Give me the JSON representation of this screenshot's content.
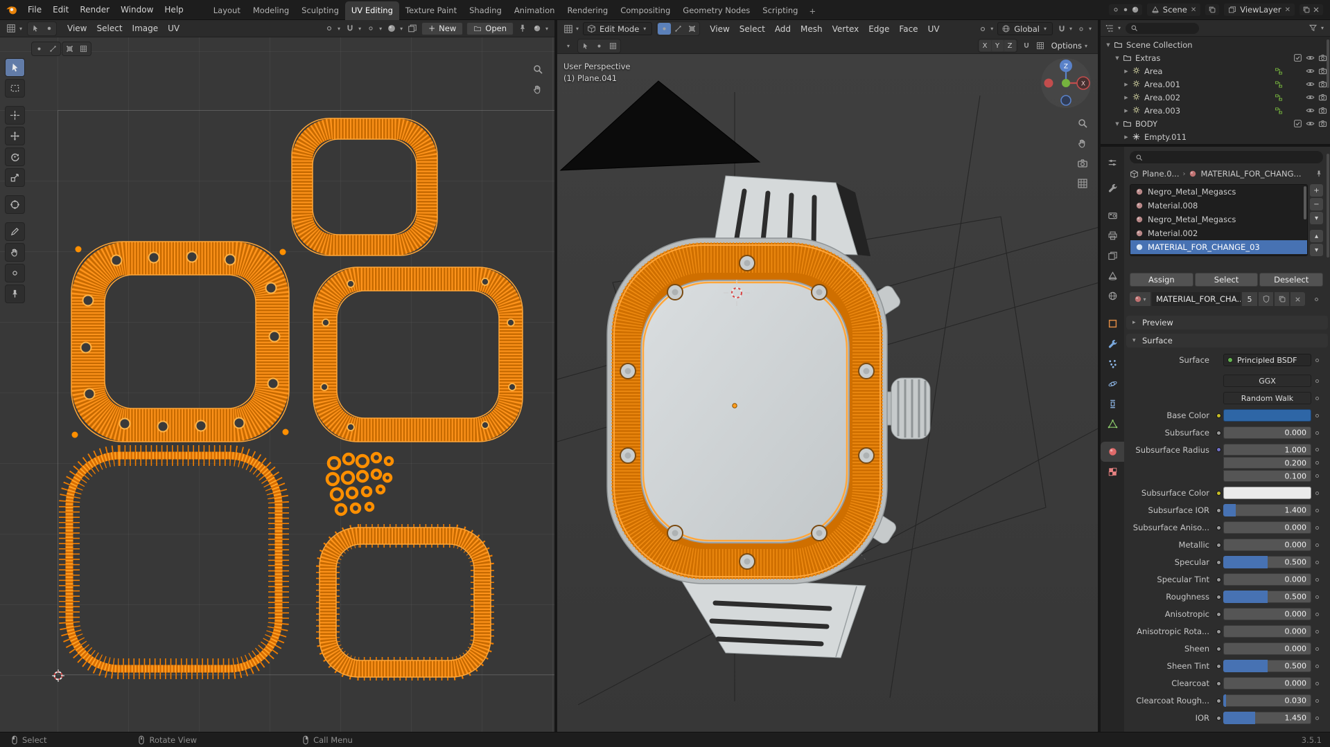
{
  "colors": {
    "accent": "#4772b3",
    "orange": "#e8830a",
    "base_color_swatch": "#2e66a6",
    "subsurface_color_swatch": "#eaeaea"
  },
  "topbar": {
    "app_menus": [
      "File",
      "Edit",
      "Render",
      "Window",
      "Help"
    ],
    "workspaces": [
      "Layout",
      "Modeling",
      "Sculpting",
      "UV Editing",
      "Texture Paint",
      "Shading",
      "Animation",
      "Rendering",
      "Compositing",
      "Geometry Nodes",
      "Scripting"
    ],
    "active_workspace": "UV Editing",
    "add_tab": "+",
    "scene_label": "Scene",
    "viewlayer_label": "ViewLayer"
  },
  "uv_editor": {
    "menus": [
      "View",
      "Select",
      "Image",
      "UV"
    ],
    "new_button": "New",
    "open_button": "Open",
    "tools": [
      "tweak",
      "select-box",
      "cursor",
      "move",
      "rotate",
      "scale",
      "transform",
      "annotate",
      "grab",
      "relax",
      "pin"
    ],
    "nav_icons": [
      "magnifier",
      "hand"
    ]
  },
  "viewport": {
    "mode": "Edit Mode",
    "menus": [
      "View",
      "Select",
      "Add",
      "Mesh",
      "Vertex",
      "Edge",
      "Face",
      "UV"
    ],
    "orientation": "Global",
    "options_button": "Options",
    "mirror_axes": [
      "X",
      "Y",
      "Z"
    ],
    "overlay_perspective": "User Perspective",
    "overlay_object": "(1) Plane.041",
    "gizmo_z": "Z",
    "gizmo_x": "X",
    "nav_icons": [
      "magnifier",
      "hand",
      "camera",
      "grid"
    ]
  },
  "outliner": {
    "rows": [
      {
        "label": "Scene Collection",
        "depth": 0,
        "icon": "collection",
        "iconcolor": "#d8d8d8",
        "arrow": "down",
        "right": "none"
      },
      {
        "label": "Extras",
        "depth": 1,
        "icon": "collection",
        "iconcolor": "#cfcfcf",
        "arrow": "down",
        "right": "collection"
      },
      {
        "label": "Area",
        "depth": 2,
        "icon": "light",
        "iconcolor": "#d6d6a4",
        "arrow": "right",
        "right": "object"
      },
      {
        "label": "Area.001",
        "depth": 2,
        "icon": "light",
        "iconcolor": "#d6d6a4",
        "arrow": "right",
        "right": "object"
      },
      {
        "label": "Area.002",
        "depth": 2,
        "icon": "light",
        "iconcolor": "#d6d6a4",
        "arrow": "right",
        "right": "object"
      },
      {
        "label": "Area.003",
        "depth": 2,
        "icon": "light",
        "iconcolor": "#d6d6a4",
        "arrow": "right",
        "right": "object"
      },
      {
        "label": "BODY",
        "depth": 1,
        "icon": "collection",
        "iconcolor": "#cfcfcf",
        "arrow": "down",
        "right": "collection"
      },
      {
        "label": "Empty.011",
        "depth": 2,
        "icon": "empty",
        "iconcolor": "#cfcfcf",
        "arrow": "right",
        "right": "none"
      }
    ]
  },
  "properties": {
    "tabs": [
      {
        "id": "tool",
        "icon": "wrench",
        "color": "#9c9c9c",
        "group": 0
      },
      {
        "id": "render",
        "icon": "camera-back",
        "color": "#9c9c9c",
        "group": 1
      },
      {
        "id": "output",
        "icon": "printer",
        "color": "#9c9c9c",
        "group": 1
      },
      {
        "id": "view-layer",
        "icon": "images",
        "color": "#9c9c9c",
        "group": 1
      },
      {
        "id": "scene",
        "icon": "cone",
        "color": "#9c9c9c",
        "group": 1
      },
      {
        "id": "world",
        "icon": "globe",
        "color": "#9c9c9c",
        "group": 1
      },
      {
        "id": "object",
        "icon": "square",
        "color": "#de8a44",
        "group": 2
      },
      {
        "id": "modifiers",
        "icon": "wrench",
        "color": "#7aa8dc",
        "group": 2
      },
      {
        "id": "particles",
        "icon": "particles",
        "color": "#8fb8e8",
        "group": 2
      },
      {
        "id": "physics",
        "icon": "physics",
        "color": "#8fb8e8",
        "group": 2
      },
      {
        "id": "constraints",
        "icon": "constraints",
        "color": "#8fb8e8",
        "group": 2
      },
      {
        "id": "object-data",
        "icon": "mesh",
        "color": "#8ecf6c",
        "group": 2
      },
      {
        "id": "material",
        "icon": "sphere",
        "color": "#e06a6a",
        "group": 3,
        "active": true
      },
      {
        "id": "texture",
        "icon": "checker",
        "color": "#e78181",
        "group": 3
      }
    ],
    "breadcrumb_object": "Plane.0...",
    "breadcrumb_material": "MATERIAL_FOR_CHANG...",
    "slots": [
      {
        "name": "Negro_Metal_Megascs",
        "selected": false
      },
      {
        "name": "Material.008",
        "selected": false
      },
      {
        "name": "Negro_Metal_Megascs",
        "selected": false
      },
      {
        "name": "Material.002",
        "selected": false
      },
      {
        "name": "MATERIAL_FOR_CHANGE_03",
        "selected": true
      }
    ],
    "slot_buttons": [
      "+",
      "−",
      "▾",
      "▴",
      "▾"
    ],
    "actions": [
      "Assign",
      "Select",
      "Deselect"
    ],
    "datablock_name": "MATERIAL_FOR_CHA...",
    "datablock_users": "5",
    "preview_section": "Preview",
    "surface_section": "Surface",
    "surface_label": "Surface",
    "surface_shader": "Principled BSDF",
    "distribution": "GGX",
    "subsurface_method": "Random Walk",
    "params": [
      {
        "label": "Base Color",
        "type": "color",
        "color": "#2e66a6",
        "socket": "#c7bd25"
      },
      {
        "label": "Subsurface",
        "type": "slider",
        "value": "0.000",
        "fill": 0,
        "socket": "#9a9a9a"
      },
      {
        "label": "Subsurface Radius",
        "type": "stack_top",
        "value": "1.000",
        "socket": "#7070c8"
      },
      {
        "label": "",
        "type": "stack_mid",
        "value": "0.200"
      },
      {
        "label": "",
        "type": "stack_bot",
        "value": "0.100"
      },
      {
        "label": "Subsurface Color",
        "type": "color",
        "color": "#eaeaea",
        "socket": "#c7bd25"
      },
      {
        "label": "Subsurface IOR",
        "type": "slider",
        "value": "1.400",
        "fill": 14,
        "socket": "#9a9a9a"
      },
      {
        "label": "Subsurface Aniso...",
        "type": "slider",
        "value": "0.000",
        "fill": 0,
        "socket": "#9a9a9a"
      },
      {
        "label": "Metallic",
        "type": "slider",
        "value": "0.000",
        "fill": 0,
        "socket": "#9a9a9a"
      },
      {
        "label": "Specular",
        "type": "slider",
        "value": "0.500",
        "fill": 50,
        "socket": "#9a9a9a"
      },
      {
        "label": "Specular Tint",
        "type": "slider",
        "value": "0.000",
        "fill": 0,
        "socket": "#9a9a9a"
      },
      {
        "label": "Roughness",
        "type": "slider",
        "value": "0.500",
        "fill": 50,
        "socket": "#9a9a9a"
      },
      {
        "label": "Anisotropic",
        "type": "slider",
        "value": "0.000",
        "fill": 0,
        "socket": "#9a9a9a"
      },
      {
        "label": "Anisotropic Rota...",
        "type": "slider",
        "value": "0.000",
        "fill": 0,
        "socket": "#9a9a9a"
      },
      {
        "label": "Sheen",
        "type": "slider",
        "value": "0.000",
        "fill": 0,
        "socket": "#9a9a9a"
      },
      {
        "label": "Sheen Tint",
        "type": "slider",
        "value": "0.500",
        "fill": 50,
        "socket": "#9a9a9a"
      },
      {
        "label": "Clearcoat",
        "type": "slider",
        "value": "0.000",
        "fill": 0,
        "socket": "#9a9a9a"
      },
      {
        "label": "Clearcoat Rough...",
        "type": "slider",
        "value": "0.030",
        "fill": 3,
        "socket": "#9a9a9a"
      },
      {
        "label": "IOR",
        "type": "slider",
        "value": "1.450",
        "fill": 36,
        "socket": "#9a9a9a"
      }
    ]
  },
  "statusbar": {
    "select": "Select",
    "rotate": "Rotate View",
    "call_menu": "Call Menu",
    "version": "3.5.1"
  }
}
